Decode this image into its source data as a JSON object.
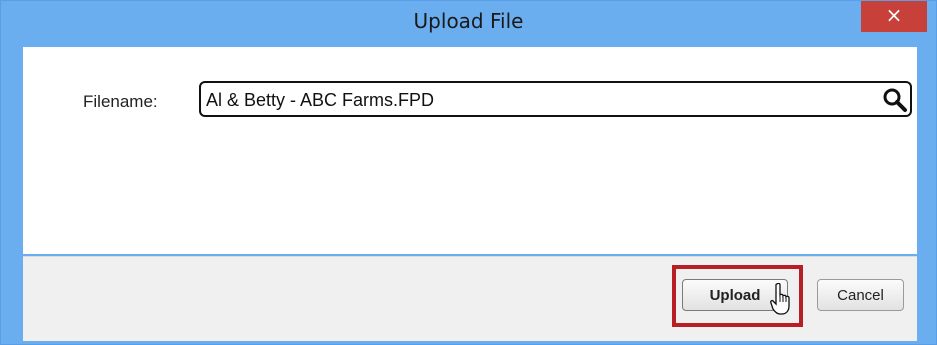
{
  "dialog": {
    "title": "Upload File",
    "close_label": "×"
  },
  "form": {
    "filename_label": "Filename:",
    "filename_value": "Al & Betty - ABC Farms.FPD",
    "search_icon": "search-icon"
  },
  "footer": {
    "upload_label": "Upload",
    "cancel_label": "Cancel"
  },
  "colors": {
    "titlebar": "#6aaeef",
    "close_button": "#c7403a",
    "highlight": "#b81f24"
  }
}
